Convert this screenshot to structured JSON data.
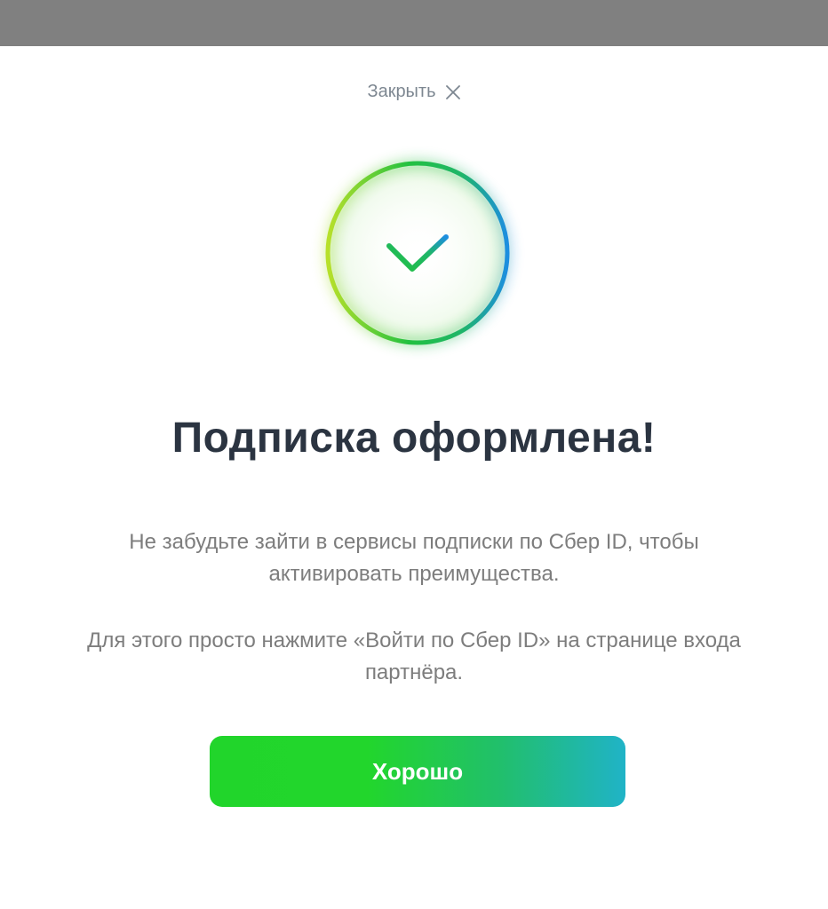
{
  "modal": {
    "close_label": "Закрыть",
    "close_icon": "close-x-icon",
    "success_icon": "check-circle-icon",
    "title": "Подписка оформлена!",
    "paragraph_1": "Не забудьте зайти в сервисы подписки по Сбер ID, чтобы активировать преимущества.",
    "paragraph_2": "Для этого просто нажмите «Войти по Сбер ID» на странице входа партнёра.",
    "ok_button_label": "Хорошо"
  },
  "colors": {
    "overlay": "#808080",
    "title": "#2b3441",
    "body_text": "#7d7d7d",
    "close_text": "#7d8791",
    "button_gradient_start": "#21d52b",
    "button_gradient_end": "#20b3c7",
    "ring_gradient_start": "#b8e02a",
    "ring_gradient_mid": "#22c140",
    "ring_gradient_end": "#1d8ee0"
  }
}
